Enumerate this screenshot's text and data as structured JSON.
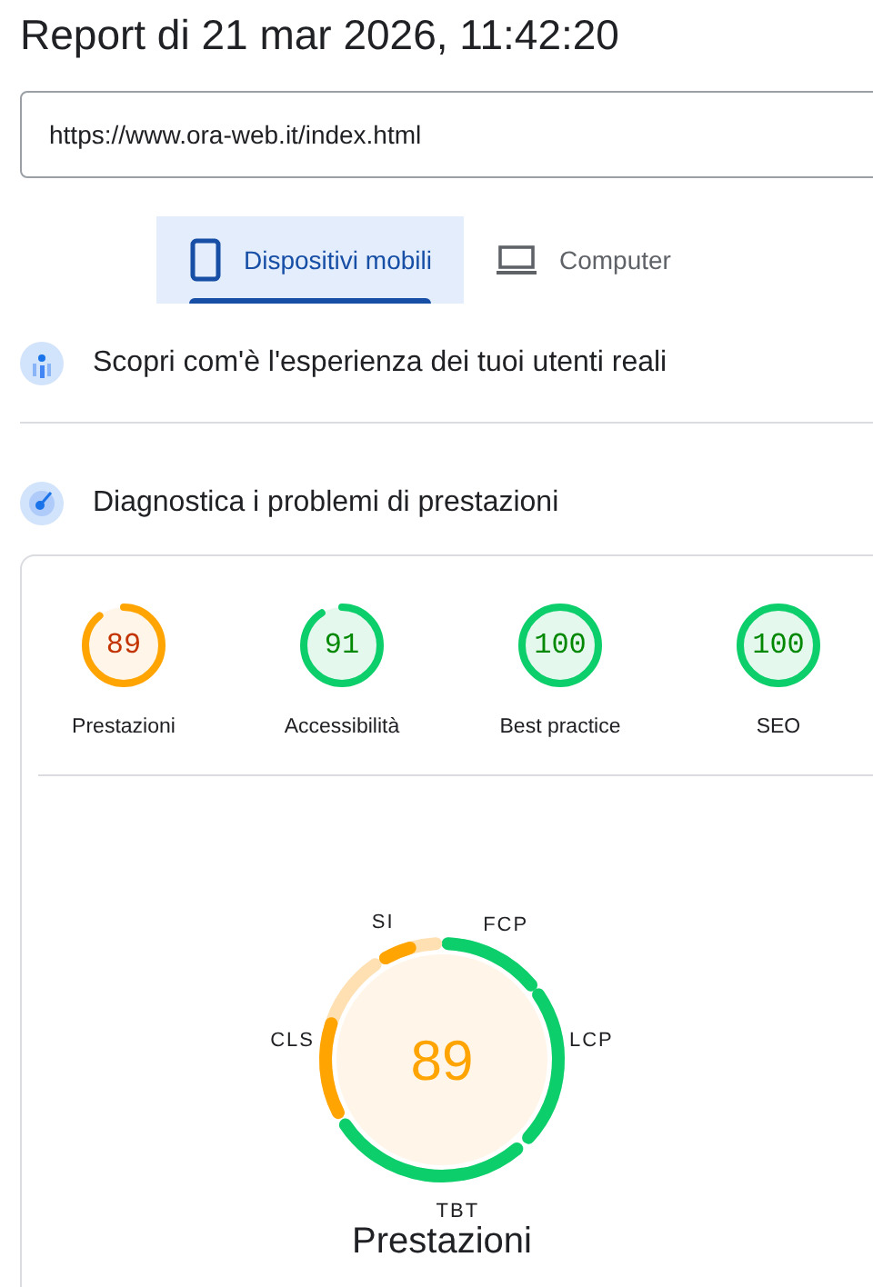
{
  "title": "Report di 21 mar 2026, 11:42:20",
  "url_field": {
    "value": "https://www.ora-web.it/index.html"
  },
  "device_tabs": [
    {
      "label": "Dispositivi mobili",
      "kind": "mobile",
      "selected": true
    },
    {
      "label": "Computer",
      "kind": "desktop",
      "selected": false
    }
  ],
  "sections": [
    {
      "kind": "field-data",
      "label": "Scopri com'è l'esperienza dei tuoi utenti reali"
    },
    {
      "kind": "lab-data",
      "label": "Diagnostica i problemi di prestazioni"
    }
  ],
  "scores": [
    {
      "label": "Prestazioni",
      "score": "89",
      "color": "#ffa400"
    },
    {
      "label": "Accessibilità",
      "score": "91",
      "color": "#0cce6b"
    },
    {
      "label": "Best practice",
      "score": "100",
      "color": "#0cce6b"
    },
    {
      "label": "SEO",
      "score": "100",
      "color": "#0cce6b"
    }
  ],
  "performance": {
    "score": "89",
    "color": "#ffa400",
    "title": "Prestazioni",
    "metrics": [
      {
        "label": "FCP",
        "color": "#0cce6b"
      },
      {
        "label": "LCP",
        "color": "#0cce6b"
      },
      {
        "label": "TBT",
        "color": "#0cce6b"
      },
      {
        "label": "CLS",
        "color": "#ffa400"
      },
      {
        "label": "SI",
        "color": "#ffa400"
      }
    ]
  }
}
